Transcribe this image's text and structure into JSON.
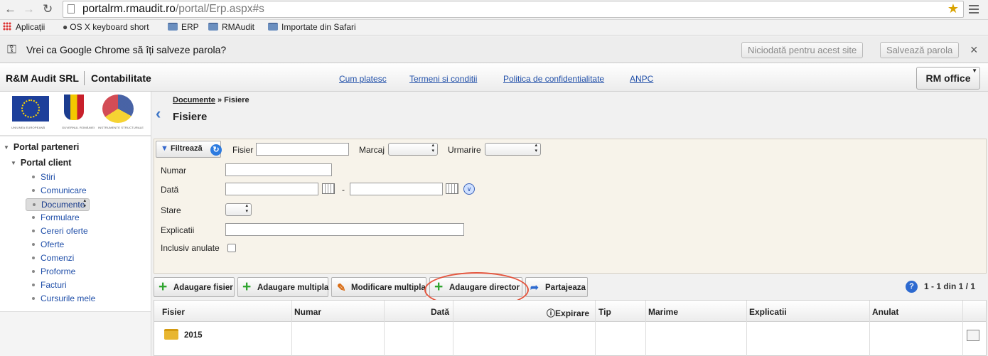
{
  "browser": {
    "url_host": "portalrm.rmaudit.ro",
    "url_path": "/portal/Erp.aspx#s",
    "bookmarks": [
      "Aplicații",
      "OS X keyboard short",
      "ERP",
      "RMAudit",
      "Importate din Safari"
    ],
    "password_prompt": "Vrei ca Google Chrome să îți salveze parola?",
    "never_button": "Niciodată pentru acest site",
    "save_button": "Salvează parola"
  },
  "header": {
    "company": "R&M Audit SRL",
    "module": "Contabilitate",
    "links": [
      "Cum platesc",
      "Termeni si conditii",
      "Politica de confidentialitate",
      "ANPC"
    ],
    "office_button": "RM office"
  },
  "sidebar": {
    "logo_captions": [
      "UNIUNEA EUROPEANĂ",
      "GUVERNUL ROMÂNIEI",
      "INSTRUMENTE STRUCTURALE"
    ],
    "root": "Portal parteneri",
    "group": "Portal client",
    "items": [
      {
        "label": "Stiri",
        "selected": false
      },
      {
        "label": "Comunicare",
        "selected": false
      },
      {
        "label": "Documente",
        "selected": true
      },
      {
        "label": "Formulare",
        "selected": false
      },
      {
        "label": "Cereri oferte",
        "selected": false
      },
      {
        "label": "Oferte",
        "selected": false
      },
      {
        "label": "Comenzi",
        "selected": false
      },
      {
        "label": "Proforme",
        "selected": false
      },
      {
        "label": "Facturi",
        "selected": false
      },
      {
        "label": "Cursurile mele",
        "selected": false
      }
    ]
  },
  "page": {
    "breadcrumb_parent": "Documente",
    "breadcrumb_sep": "»",
    "breadcrumb_current": "Fisiere",
    "title": "Fisiere"
  },
  "filter": {
    "filter_button": "Filtrează",
    "file_label": "Fisier",
    "file_value": "",
    "mark_label": "Marcaj",
    "follow_label": "Urmarire",
    "number_label": "Numar",
    "date_label": "Dată",
    "date_sep": "-",
    "status_label": "Stare",
    "explanations_label": "Explicatii",
    "include_cancelled_label": "Inclusiv anulate"
  },
  "toolbar": {
    "add_file": "Adaugare fisier",
    "add_multiple": "Adaugare multipla",
    "modify_multiple": "Modificare multipla",
    "add_directory": "Adaugare director",
    "share": "Partajeaza",
    "help": "?",
    "pager": "1 - 1 din 1 /  1"
  },
  "grid": {
    "columns": [
      "Fisier",
      "Numar",
      "Dată",
      "Expirare",
      "Tip",
      "Marime",
      "Explicatii",
      "Anulat"
    ],
    "rows": [
      {
        "name": "2015",
        "type": "folder"
      }
    ]
  },
  "colors": {
    "link": "#1f4ea8",
    "highlight_oval": "#e4553e",
    "filter_bg": "#f7f3ea"
  }
}
